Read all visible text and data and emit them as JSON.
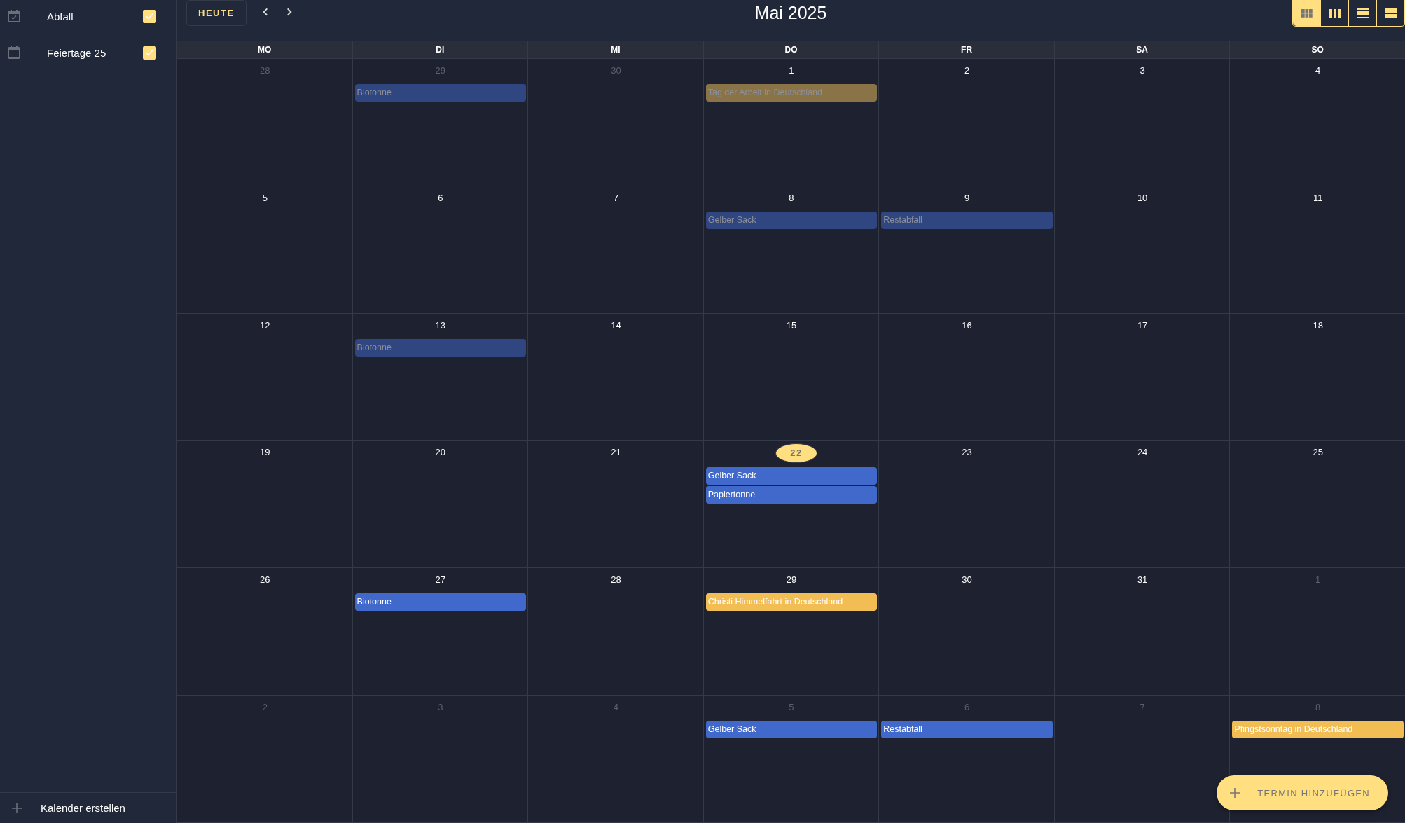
{
  "sidebar": {
    "calendars": [
      {
        "name": "Abfall",
        "checked": true,
        "kind": "checked-calendar"
      },
      {
        "name": "Feiertage 25",
        "checked": true,
        "kind": "calendar"
      }
    ],
    "create_label": "Kalender erstellen"
  },
  "toolbar": {
    "today_button": "HEUTE",
    "title": "Mai 2025",
    "views": [
      {
        "kind": "month",
        "selected": true
      },
      {
        "kind": "week",
        "selected": false
      },
      {
        "kind": "day",
        "selected": false
      },
      {
        "kind": "list",
        "selected": false
      }
    ]
  },
  "weekdays": [
    "MO",
    "DI",
    "MI",
    "DO",
    "FR",
    "SA",
    "SO"
  ],
  "days": [
    {
      "label": "28",
      "in_month": false,
      "today": false
    },
    {
      "label": "29",
      "in_month": false,
      "today": false,
      "events": [
        {
          "title": "Biotonne",
          "color": "#2f4680",
          "past": true
        }
      ]
    },
    {
      "label": "30",
      "in_month": false,
      "today": false
    },
    {
      "label": "1",
      "in_month": true,
      "today": false,
      "events": [
        {
          "title": "Tag der Arbeit in Deutschland",
          "color": "#8a7447",
          "past": true
        }
      ]
    },
    {
      "label": "2",
      "in_month": true,
      "today": false
    },
    {
      "label": "3",
      "in_month": true,
      "today": false
    },
    {
      "label": "4",
      "in_month": true,
      "today": false
    },
    {
      "label": "5",
      "in_month": true,
      "today": false
    },
    {
      "label": "6",
      "in_month": true,
      "today": false
    },
    {
      "label": "7",
      "in_month": true,
      "today": false
    },
    {
      "label": "8",
      "in_month": true,
      "today": false,
      "events": [
        {
          "title": "Gelber Sack",
          "color": "#2f4680",
          "past": true
        }
      ]
    },
    {
      "label": "9",
      "in_month": true,
      "today": false,
      "events": [
        {
          "title": "Restabfall",
          "color": "#2f4680",
          "past": true
        }
      ]
    },
    {
      "label": "10",
      "in_month": true,
      "today": false
    },
    {
      "label": "11",
      "in_month": true,
      "today": false
    },
    {
      "label": "12",
      "in_month": true,
      "today": false
    },
    {
      "label": "13",
      "in_month": true,
      "today": false,
      "events": [
        {
          "title": "Biotonne",
          "color": "#2f4680",
          "past": true
        }
      ]
    },
    {
      "label": "14",
      "in_month": true,
      "today": false
    },
    {
      "label": "15",
      "in_month": true,
      "today": false
    },
    {
      "label": "16",
      "in_month": true,
      "today": false
    },
    {
      "label": "17",
      "in_month": true,
      "today": false
    },
    {
      "label": "18",
      "in_month": true,
      "today": false
    },
    {
      "label": "19",
      "in_month": true,
      "today": false
    },
    {
      "label": "20",
      "in_month": true,
      "today": false
    },
    {
      "label": "21",
      "in_month": true,
      "today": false
    },
    {
      "label": "22",
      "in_month": true,
      "today": true,
      "events": [
        {
          "title": "Gelber Sack",
          "color": "#4169cc",
          "past": false
        },
        {
          "title": "Papiertonne",
          "color": "#4169cc",
          "past": false
        }
      ]
    },
    {
      "label": "23",
      "in_month": true,
      "today": false
    },
    {
      "label": "24",
      "in_month": true,
      "today": false
    },
    {
      "label": "25",
      "in_month": true,
      "today": false
    },
    {
      "label": "26",
      "in_month": true,
      "today": false
    },
    {
      "label": "27",
      "in_month": true,
      "today": false,
      "events": [
        {
          "title": "Biotonne",
          "color": "#4169cc",
          "past": false
        }
      ]
    },
    {
      "label": "28",
      "in_month": true,
      "today": false
    },
    {
      "label": "29",
      "in_month": true,
      "today": false,
      "events": [
        {
          "title": "Christi Himmelfahrt in Deutschland",
          "color": "#f2bd52",
          "past": false
        }
      ]
    },
    {
      "label": "30",
      "in_month": true,
      "today": false
    },
    {
      "label": "31",
      "in_month": true,
      "today": false
    },
    {
      "label": "1",
      "in_month": false,
      "today": false
    },
    {
      "label": "2",
      "in_month": false,
      "today": false
    },
    {
      "label": "3",
      "in_month": false,
      "today": false
    },
    {
      "label": "4",
      "in_month": false,
      "today": false
    },
    {
      "label": "5",
      "in_month": false,
      "today": false,
      "events": [
        {
          "title": "Gelber Sack",
          "color": "#4169cc",
          "past": false
        }
      ]
    },
    {
      "label": "6",
      "in_month": false,
      "today": false,
      "events": [
        {
          "title": "Restabfall",
          "color": "#4169cc",
          "past": false
        }
      ]
    },
    {
      "label": "7",
      "in_month": false,
      "today": false
    },
    {
      "label": "8",
      "in_month": false,
      "today": false,
      "events": [
        {
          "title": "Pfingstsonntag in Deutschland",
          "color": "#f2bd52",
          "past": false
        }
      ]
    }
  ],
  "add_button": "TERMIN HINZUFÜGEN"
}
